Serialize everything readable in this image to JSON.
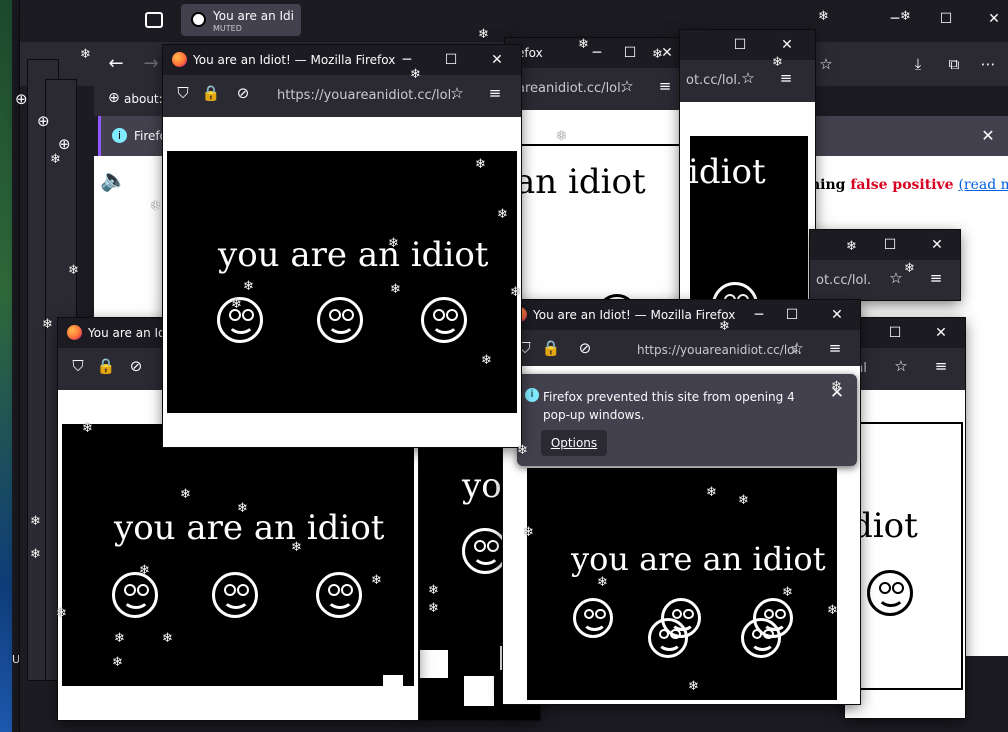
{
  "top_tab": {
    "title": "You are an Idi",
    "sub": "MUTED"
  },
  "window_title": "You are an Idiot! — Mozilla Firefox",
  "window_title_short": "You are an Idi",
  "url_full": "https://youareanidiot.cc/lol.",
  "url_partial_a": "areanidiot.cc/lol.",
  "url_partial_b": "ot.cc/lol.",
  "url_partial_c": "areanidiot.cc/lol.",
  "url_small": "nl",
  "about_text": "about:",
  "firefox_short": "Firefo",
  "firefox_tab_short": "efox",
  "idiot_text": "you are an idiot",
  "idiot_partial_a": "an idiot",
  "idiot_partial_b": "idiot",
  "idiot_partial_c": "yo",
  "idiot_partial_d": "diot",
  "popup_notice": {
    "message": "Firefox prevented this site from opening 4 pop-up windows.",
    "options_label": "Options"
  },
  "background_page": {
    "text_before": "hing",
    "false_positive": "false positive",
    "read_more": "(read more)"
  },
  "desktop_label": "Un",
  "icons": {
    "minimize": "minimize-icon",
    "maximize": "maximize-icon",
    "close": "close-icon",
    "back": "back-arrow-icon",
    "shield": "shield-icon",
    "lock": "lock-icon",
    "permissions": "permissions-icon",
    "star": "bookmark-star-icon",
    "menu": "hamburger-menu-icon",
    "download": "download-icon",
    "extensions": "extensions-icon",
    "info": "info-icon",
    "speaker": "speaker-icon",
    "snowflake": "snowflake-icon"
  },
  "colors": {
    "titlebar": "#1c1b22",
    "toolbar": "#2b2a33",
    "accent_red": "#d70022",
    "link_blue": "#0060df"
  }
}
